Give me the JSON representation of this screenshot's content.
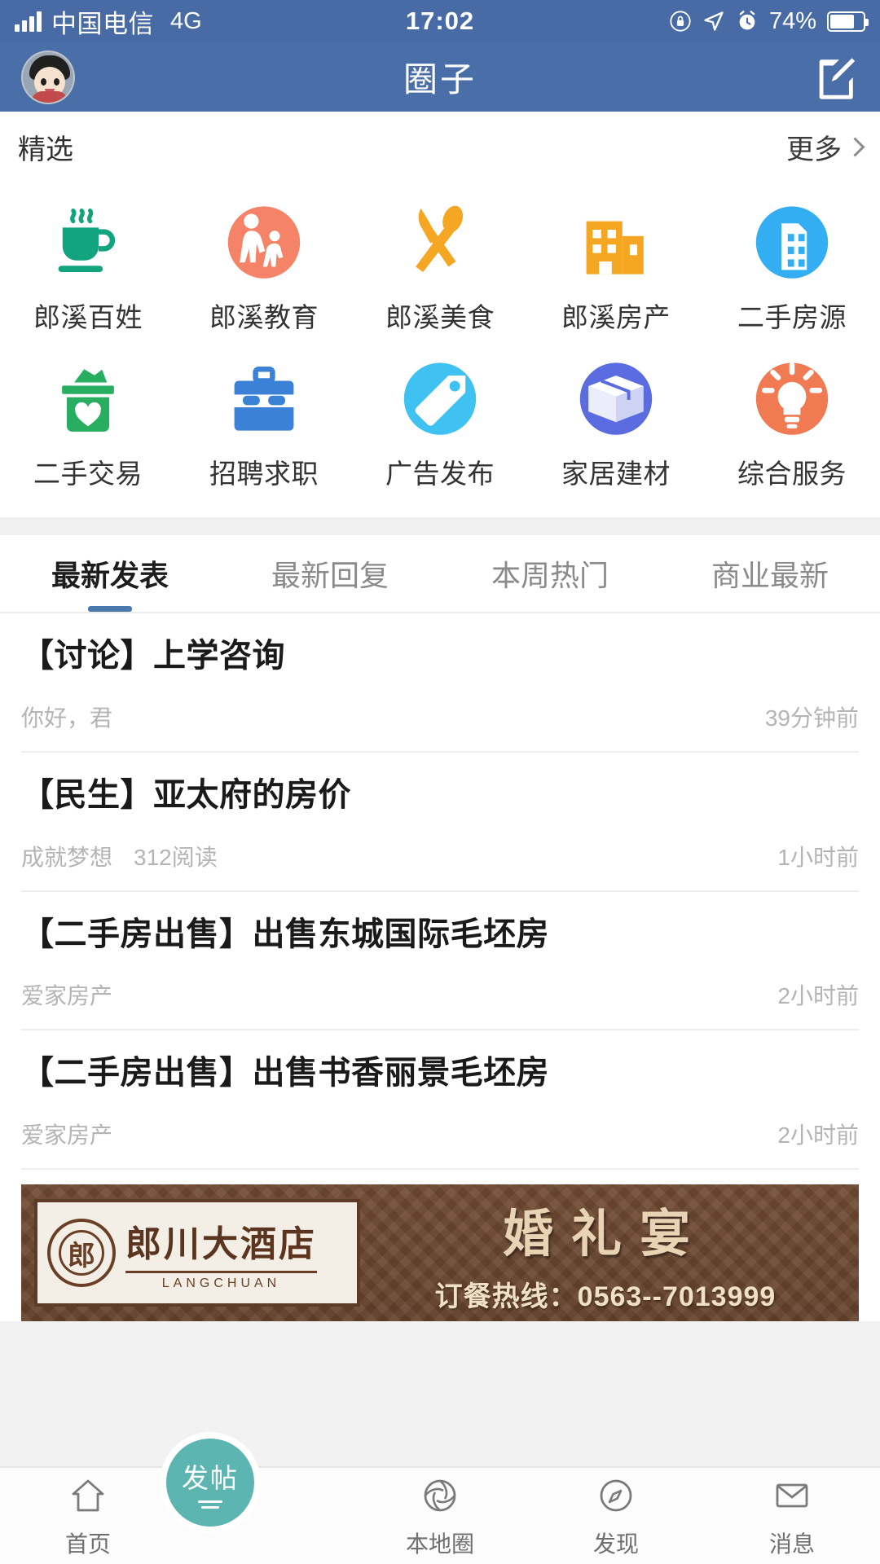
{
  "status_bar": {
    "carrier": "中国电信",
    "network": "4G",
    "time": "17:02",
    "battery_percent": "74%",
    "battery_level": 74,
    "icons": [
      "signal-bars-icon",
      "rotation-lock-icon",
      "location-arrow-icon",
      "alarm-clock-icon",
      "battery-icon"
    ]
  },
  "nav": {
    "title": "圈子",
    "avatar_name": "user-avatar",
    "compose_icon": "compose-edit-icon"
  },
  "featured": {
    "title": "精选",
    "more_label": "更多",
    "items": [
      {
        "label": "郎溪百姓",
        "icon": "coffee-cup-icon",
        "style": "flat",
        "color": "#12A47F"
      },
      {
        "label": "郎溪教育",
        "icon": "parent-child-icon",
        "style": "circle",
        "color": "#F58368"
      },
      {
        "label": "郎溪美食",
        "icon": "fork-spoon-icon",
        "style": "flat",
        "color": "#F5A623"
      },
      {
        "label": "郎溪房产",
        "icon": "office-building-icon",
        "style": "flat",
        "color": "#F5A623"
      },
      {
        "label": "二手房源",
        "icon": "building-circle-icon",
        "style": "circle",
        "color": "#34AEF3"
      },
      {
        "label": "二手交易",
        "icon": "money-box-heart-icon",
        "style": "flat",
        "color": "#27AE60"
      },
      {
        "label": "招聘求职",
        "icon": "briefcase-icon",
        "style": "flat",
        "color": "#3B82D6"
      },
      {
        "label": "广告发布",
        "icon": "price-tag-icon",
        "style": "circle",
        "color": "#3FC1F2"
      },
      {
        "label": "家居建材",
        "icon": "package-box-icon",
        "style": "circle",
        "color": "#5A6CE0"
      },
      {
        "label": "综合服务",
        "icon": "lightbulb-icon",
        "style": "circle",
        "color": "#F07A52"
      }
    ]
  },
  "tabs": {
    "active_index": 0,
    "items": [
      {
        "label": "最新发表"
      },
      {
        "label": "最新回复"
      },
      {
        "label": "本周热门"
      },
      {
        "label": "商业最新"
      }
    ]
  },
  "posts": [
    {
      "title": "【讨论】上学咨询",
      "author": "你好，君",
      "reads": "",
      "time": "39分钟前"
    },
    {
      "title": "【民生】亚太府的房价",
      "author": "成就梦想",
      "reads": "312阅读",
      "time": "1小时前"
    },
    {
      "title": "【二手房出售】出售东城国际毛坯房",
      "author": "爱家房产",
      "reads": "",
      "time": "2小时前"
    },
    {
      "title": "【二手房出售】出售书香丽景毛坯房",
      "author": "爱家房产",
      "reads": "",
      "time": "2小时前"
    }
  ],
  "banner": {
    "seal_text": "郎",
    "hotel_name": "郎川大酒店",
    "pinyin": "LANGCHUAN",
    "headline": "婚礼宴",
    "phone_line": "订餐热线：0563--7013999"
  },
  "bottom_nav": {
    "fab": {
      "label": "发帖",
      "icon": "post-create-icon",
      "color": "#5CB5B0"
    },
    "items": [
      {
        "label": "首页",
        "icon": "home-icon"
      },
      {
        "label": "本地圈",
        "icon": "aperture-icon"
      },
      {
        "label": "发现",
        "icon": "compass-icon"
      },
      {
        "label": "消息",
        "icon": "mail-envelope-icon"
      }
    ]
  },
  "colors": {
    "header_blue": "#4A6EA8",
    "tab_indicator": "#4A7AAD",
    "fab_teal": "#5CB5B0"
  }
}
